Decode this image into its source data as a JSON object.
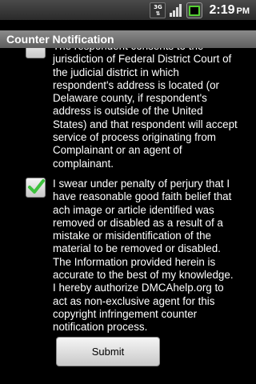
{
  "status_bar": {
    "network_badge": "3G",
    "icons": [
      "3g-icon",
      "signal-icon",
      "battery-icon"
    ],
    "time": "2:19",
    "ampm": "PM"
  },
  "title_bar": {
    "title": "Counter Notification"
  },
  "items": [
    {
      "checked": false,
      "text": "The respondent consents to the\njurisdiction of Federal District Court of\nthe judicial district in which\nrespondent's address is located (or\nDelaware county, if respondent's\naddress is outside of the United\nStates) and that respondent will accept\nservice of process originating from\nComplainant or an agent of\ncomplainant."
    },
    {
      "checked": true,
      "text": "I swear under penalty of perjury that I\nhave reasonable good faith belief that\nach image or article identified was\nremoved or disabled as a result of a\nmistake or misidentification of the\nmaterial to be removed or disabled.\nThe Information provided herein is\naccurate to the best of my knowledge.\nI hereby authorize DMCAhelp.org to\nact as non-exclusive agent for this\ncopyright infringement counter\nnotification process."
    }
  ],
  "submit_button": {
    "label": "Submit"
  },
  "colors": {
    "check_mark": "#3cc13c",
    "battery": "#55d033"
  }
}
